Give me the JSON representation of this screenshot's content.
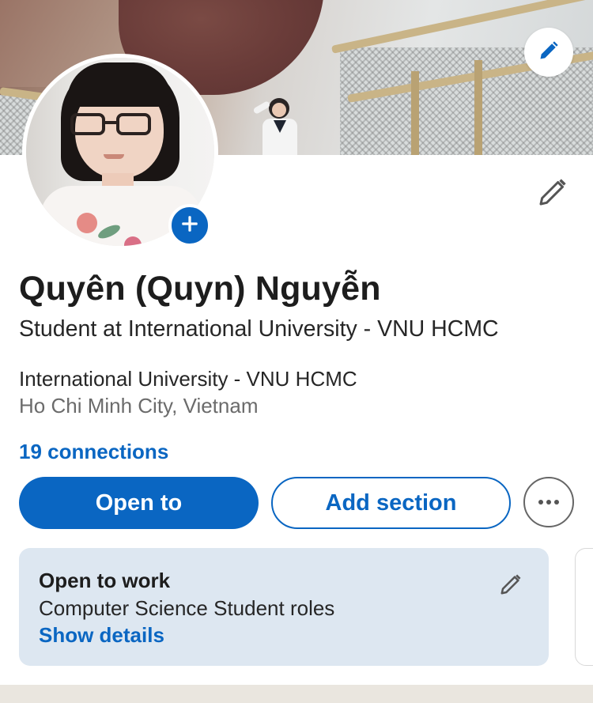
{
  "profile": {
    "name": "Quyên (Quyn) Nguyễn",
    "headline": "Student at International University - VNU HCMC",
    "school": "International University - VNU HCMC",
    "location": "Ho Chi Minh City, Vietnam",
    "connections": "19 connections"
  },
  "actions": {
    "primary_label": "Open to",
    "secondary_label": "Add section",
    "more_icon": "more-horizontal-icon"
  },
  "open_to_work": {
    "title": "Open to work",
    "roles": "Computer Science Student roles",
    "details_link": "Show details"
  },
  "icons": {
    "cover_edit": "pencil-icon",
    "avatar_add": "plus-icon",
    "profile_edit": "pencil-icon",
    "card_edit": "pencil-icon"
  },
  "colors": {
    "accent": "#0a66c2",
    "card_background": "#dde7f1",
    "divider": "#eae6df"
  }
}
